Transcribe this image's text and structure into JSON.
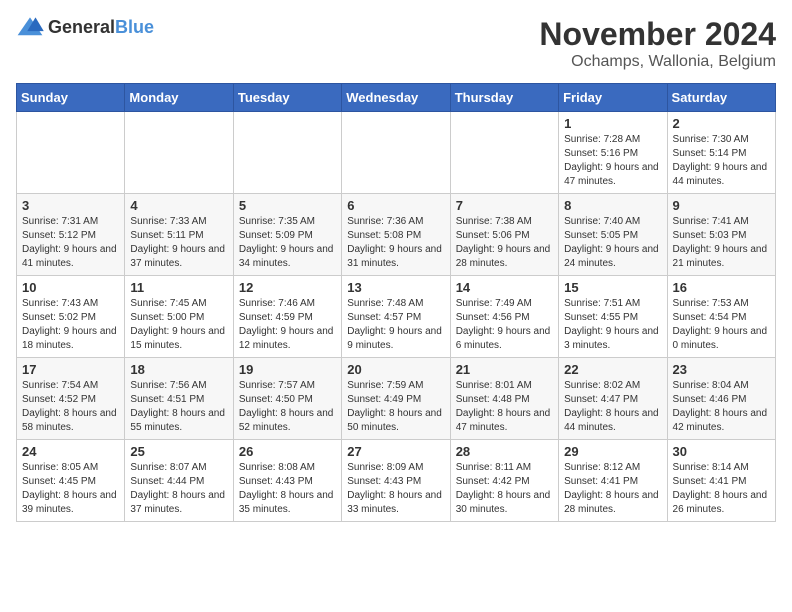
{
  "header": {
    "logo_general": "General",
    "logo_blue": "Blue",
    "month_year": "November 2024",
    "location": "Ochamps, Wallonia, Belgium"
  },
  "days_of_week": [
    "Sunday",
    "Monday",
    "Tuesday",
    "Wednesday",
    "Thursday",
    "Friday",
    "Saturday"
  ],
  "weeks": [
    [
      {
        "day": "",
        "info": ""
      },
      {
        "day": "",
        "info": ""
      },
      {
        "day": "",
        "info": ""
      },
      {
        "day": "",
        "info": ""
      },
      {
        "day": "",
        "info": ""
      },
      {
        "day": "1",
        "info": "Sunrise: 7:28 AM\nSunset: 5:16 PM\nDaylight: 9 hours and 47 minutes."
      },
      {
        "day": "2",
        "info": "Sunrise: 7:30 AM\nSunset: 5:14 PM\nDaylight: 9 hours and 44 minutes."
      }
    ],
    [
      {
        "day": "3",
        "info": "Sunrise: 7:31 AM\nSunset: 5:12 PM\nDaylight: 9 hours and 41 minutes."
      },
      {
        "day": "4",
        "info": "Sunrise: 7:33 AM\nSunset: 5:11 PM\nDaylight: 9 hours and 37 minutes."
      },
      {
        "day": "5",
        "info": "Sunrise: 7:35 AM\nSunset: 5:09 PM\nDaylight: 9 hours and 34 minutes."
      },
      {
        "day": "6",
        "info": "Sunrise: 7:36 AM\nSunset: 5:08 PM\nDaylight: 9 hours and 31 minutes."
      },
      {
        "day": "7",
        "info": "Sunrise: 7:38 AM\nSunset: 5:06 PM\nDaylight: 9 hours and 28 minutes."
      },
      {
        "day": "8",
        "info": "Sunrise: 7:40 AM\nSunset: 5:05 PM\nDaylight: 9 hours and 24 minutes."
      },
      {
        "day": "9",
        "info": "Sunrise: 7:41 AM\nSunset: 5:03 PM\nDaylight: 9 hours and 21 minutes."
      }
    ],
    [
      {
        "day": "10",
        "info": "Sunrise: 7:43 AM\nSunset: 5:02 PM\nDaylight: 9 hours and 18 minutes."
      },
      {
        "day": "11",
        "info": "Sunrise: 7:45 AM\nSunset: 5:00 PM\nDaylight: 9 hours and 15 minutes."
      },
      {
        "day": "12",
        "info": "Sunrise: 7:46 AM\nSunset: 4:59 PM\nDaylight: 9 hours and 12 minutes."
      },
      {
        "day": "13",
        "info": "Sunrise: 7:48 AM\nSunset: 4:57 PM\nDaylight: 9 hours and 9 minutes."
      },
      {
        "day": "14",
        "info": "Sunrise: 7:49 AM\nSunset: 4:56 PM\nDaylight: 9 hours and 6 minutes."
      },
      {
        "day": "15",
        "info": "Sunrise: 7:51 AM\nSunset: 4:55 PM\nDaylight: 9 hours and 3 minutes."
      },
      {
        "day": "16",
        "info": "Sunrise: 7:53 AM\nSunset: 4:54 PM\nDaylight: 9 hours and 0 minutes."
      }
    ],
    [
      {
        "day": "17",
        "info": "Sunrise: 7:54 AM\nSunset: 4:52 PM\nDaylight: 8 hours and 58 minutes."
      },
      {
        "day": "18",
        "info": "Sunrise: 7:56 AM\nSunset: 4:51 PM\nDaylight: 8 hours and 55 minutes."
      },
      {
        "day": "19",
        "info": "Sunrise: 7:57 AM\nSunset: 4:50 PM\nDaylight: 8 hours and 52 minutes."
      },
      {
        "day": "20",
        "info": "Sunrise: 7:59 AM\nSunset: 4:49 PM\nDaylight: 8 hours and 50 minutes."
      },
      {
        "day": "21",
        "info": "Sunrise: 8:01 AM\nSunset: 4:48 PM\nDaylight: 8 hours and 47 minutes."
      },
      {
        "day": "22",
        "info": "Sunrise: 8:02 AM\nSunset: 4:47 PM\nDaylight: 8 hours and 44 minutes."
      },
      {
        "day": "23",
        "info": "Sunrise: 8:04 AM\nSunset: 4:46 PM\nDaylight: 8 hours and 42 minutes."
      }
    ],
    [
      {
        "day": "24",
        "info": "Sunrise: 8:05 AM\nSunset: 4:45 PM\nDaylight: 8 hours and 39 minutes."
      },
      {
        "day": "25",
        "info": "Sunrise: 8:07 AM\nSunset: 4:44 PM\nDaylight: 8 hours and 37 minutes."
      },
      {
        "day": "26",
        "info": "Sunrise: 8:08 AM\nSunset: 4:43 PM\nDaylight: 8 hours and 35 minutes."
      },
      {
        "day": "27",
        "info": "Sunrise: 8:09 AM\nSunset: 4:43 PM\nDaylight: 8 hours and 33 minutes."
      },
      {
        "day": "28",
        "info": "Sunrise: 8:11 AM\nSunset: 4:42 PM\nDaylight: 8 hours and 30 minutes."
      },
      {
        "day": "29",
        "info": "Sunrise: 8:12 AM\nSunset: 4:41 PM\nDaylight: 8 hours and 28 minutes."
      },
      {
        "day": "30",
        "info": "Sunrise: 8:14 AM\nSunset: 4:41 PM\nDaylight: 8 hours and 26 minutes."
      }
    ]
  ]
}
